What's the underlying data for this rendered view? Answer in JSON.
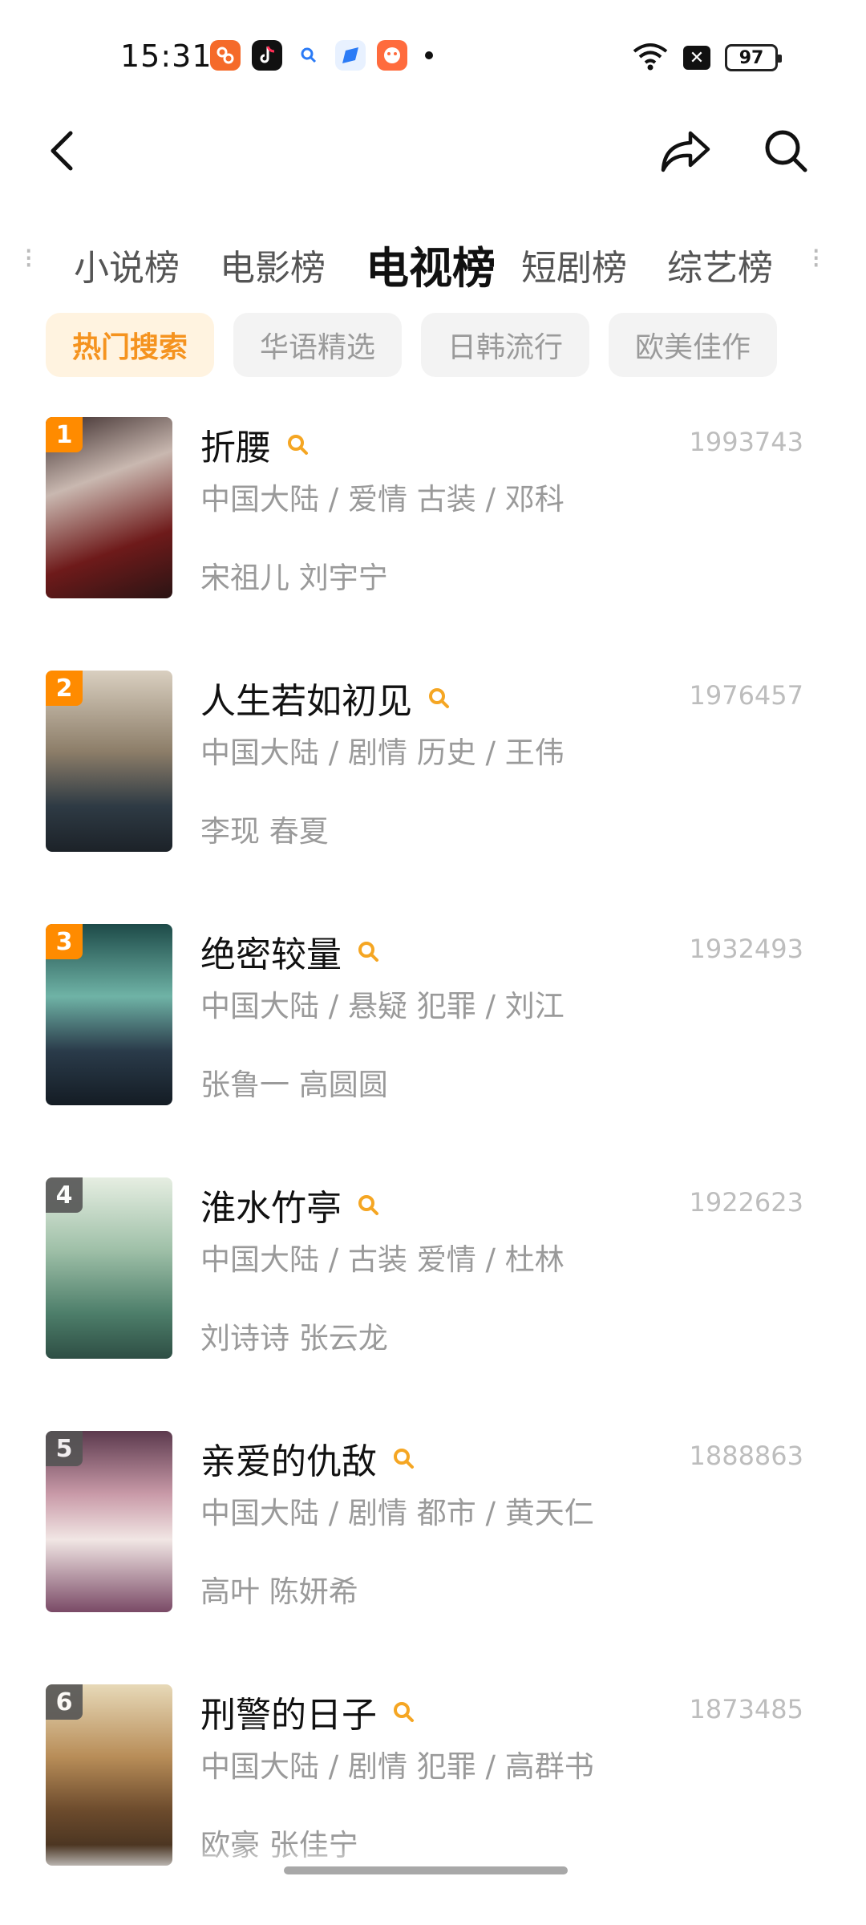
{
  "status_bar": {
    "time": "15:31",
    "battery": "97",
    "app_icons": [
      "app-icon-1",
      "douyin-icon",
      "search-app-icon",
      "browser-app-icon",
      "game-app-icon"
    ]
  },
  "nav": {
    "back_icon": "chevron-left-icon",
    "share_icon": "share-arrow-icon",
    "search_icon": "search-icon"
  },
  "tabs": {
    "left_edge": "⁝",
    "right_edge": "⁝",
    "items": [
      "小说榜",
      "电影榜",
      "电视榜",
      "短剧榜",
      "综艺榜"
    ],
    "active": "电视榜"
  },
  "filters": {
    "items": [
      "热门搜索",
      "华语精选",
      "日韩流行",
      "欧美佳作"
    ],
    "active": "热门搜索"
  },
  "colors": {
    "accent": "#f5931f",
    "rank_top": "#ff8b00",
    "rank_other": "#555555"
  },
  "shows": [
    {
      "rank": "1",
      "title": "折腰",
      "score": "1993743",
      "meta": "中国大陆 / 爱情 古装 / 邓科",
      "cast": "宋祖儿 刘宇宁"
    },
    {
      "rank": "2",
      "title": "人生若如初见",
      "score": "1976457",
      "meta": "中国大陆 / 剧情 历史 / 王伟",
      "cast": "李现 春夏"
    },
    {
      "rank": "3",
      "title": "绝密较量",
      "score": "1932493",
      "meta": "中国大陆 / 悬疑 犯罪 / 刘江",
      "cast": "张鲁一 高圆圆"
    },
    {
      "rank": "4",
      "title": "淮水竹亭",
      "score": "1922623",
      "meta": "中国大陆 / 古装 爱情 / 杜林",
      "cast": "刘诗诗 张云龙"
    },
    {
      "rank": "5",
      "title": "亲爱的仇敌",
      "score": "1888863",
      "meta": "中国大陆 / 剧情 都市 / 黄天仁",
      "cast": "高叶 陈妍希"
    },
    {
      "rank": "6",
      "title": "刑警的日子",
      "score": "1873485",
      "meta": "中国大陆 / 剧情 犯罪 / 高群书",
      "cast": "欧豪 张佳宁"
    }
  ]
}
